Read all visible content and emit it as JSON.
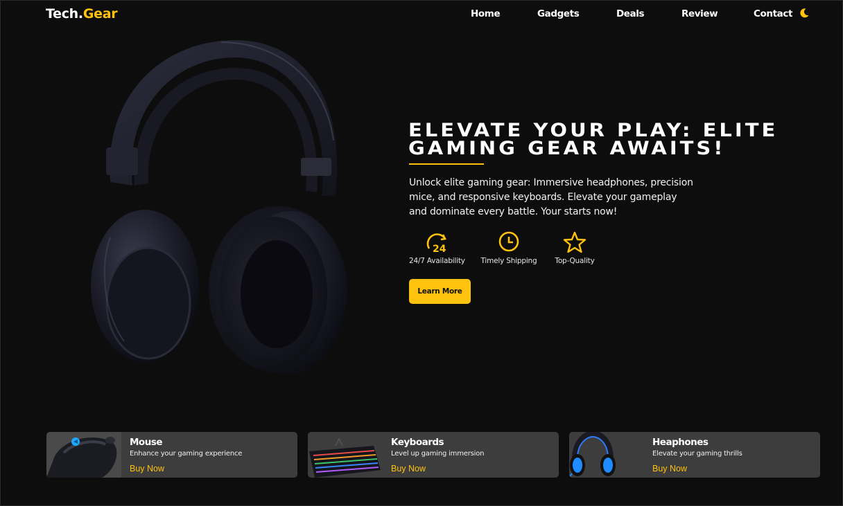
{
  "brand": {
    "name": "Tech.",
    "accent": "Gear",
    "accent_color": "#ffc20e"
  },
  "nav": {
    "items": [
      {
        "label": "Home"
      },
      {
        "label": "Gadgets"
      },
      {
        "label": "Deals"
      },
      {
        "label": "Review"
      },
      {
        "label": "Contact"
      }
    ],
    "theme_icon": "moon-icon"
  },
  "hero": {
    "title": "Elevate Your Play: Elite Gaming Gear Awaits!",
    "description": "Unlock elite gaming gear: Immersive headphones, precision mice, and responsive keyboards. Elevate your gameplay and dominate every battle. Your starts now!",
    "features": [
      {
        "icon": "24-hour-icon",
        "label": "24/7 Availability"
      },
      {
        "icon": "clock-icon",
        "label": "Timely Shipping"
      },
      {
        "icon": "star-icon",
        "label": "Top-Quality"
      }
    ],
    "cta_label": "Learn More",
    "image": "headphones-image"
  },
  "categories": [
    {
      "title": "Mouse",
      "subtitle": "Enhance your gaming experience",
      "action": "Buy Now",
      "image": "gaming-mouse-image"
    },
    {
      "title": "Keyboards",
      "subtitle": "Level up gaming immersion",
      "action": "Buy Now",
      "image": "gaming-keyboard-image"
    },
    {
      "title": "Heaphones",
      "subtitle": "Elevate your gaming thrills",
      "action": "Buy Now",
      "image": "gaming-headset-image"
    }
  ],
  "colors": {
    "background": "#0d0d0d",
    "accent": "#ffc20e",
    "card": "#3d3d3d"
  }
}
